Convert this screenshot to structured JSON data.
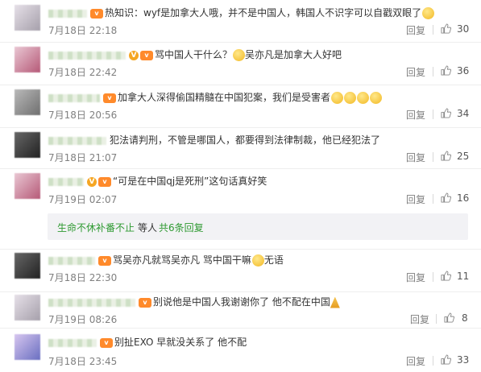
{
  "ui": {
    "reply_label": "回复"
  },
  "comments": [
    {
      "text": "热知识：wyf是加拿大人哦，并不是中国人，韩国人不识字可以自戳双眼了",
      "time": "7月18日 22:18",
      "likes": "30"
    },
    {
      "text_a": "骂中国人干什么？",
      "text_b": "吴亦凡是加拿大人好吧",
      "time": "7月18日 22:42",
      "likes": "36"
    },
    {
      "text": "加拿大人深得偷国精髓在中国犯案，我们是受害者",
      "time": "7月18日 20:56",
      "likes": "34"
    },
    {
      "text": "犯法请判刑，不管是哪国人，都要得到法律制裁，他已经犯法了",
      "time": "7月18日 21:07",
      "likes": "25"
    },
    {
      "text": "“可是在中国qj是死刑”这句话真好笑",
      "time": "7月19日 02:07",
      "likes": "16"
    },
    {
      "text_a": "骂吴亦凡就骂吴亦凡 骂中国干嘛",
      "text_b": "无语",
      "time": "7月18日 22:30",
      "likes": "11"
    },
    {
      "text": "别说他是中国人我谢谢你了 他不配在中国",
      "time": "7月19日 08:26",
      "likes": "8"
    },
    {
      "text": "别扯EXO 早就没关系了 他不配",
      "time": "7月18日 23:45",
      "likes": "33"
    }
  ],
  "subreply": {
    "user": "生命不休补番不止",
    "middle": "等人",
    "link": "共6条回复"
  }
}
